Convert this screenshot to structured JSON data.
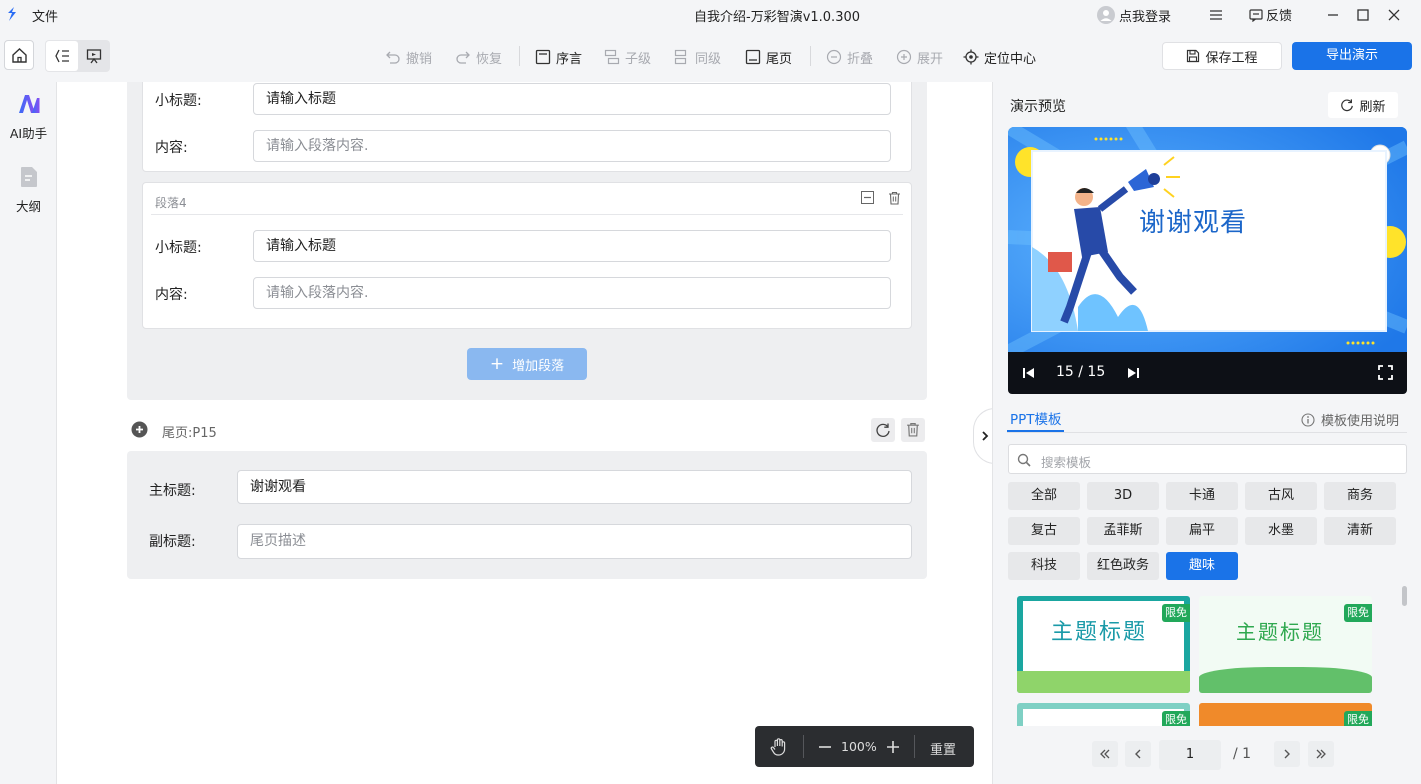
{
  "titlebar": {
    "file_menu": "文件",
    "app_title": "自我介绍-万彩智演v1.0.300",
    "login": "点我登录",
    "feedback": "反馈"
  },
  "toolbar": {
    "undo": "撤销",
    "redo": "恢复",
    "preface": "序言",
    "child": "子级",
    "sibling": "同级",
    "ending": "尾页",
    "collapse": "折叠",
    "expand": "展开",
    "locate_center": "定位中心",
    "save_project": "保存工程",
    "export": "导出演示"
  },
  "left_rail": {
    "ai_assistant": "AI助手",
    "outline": "大纲"
  },
  "editor": {
    "paragraph3": {
      "subtitle_label": "小标题:",
      "subtitle_placeholder": "请输入标题",
      "content_label": "内容:",
      "content_placeholder": "请输入段落内容."
    },
    "paragraph4": {
      "header": "段落4",
      "subtitle_label": "小标题:",
      "subtitle_placeholder": "请输入标题",
      "content_label": "内容:",
      "content_placeholder": "请输入段落内容."
    },
    "add_paragraph": "增加段落",
    "ending_page": {
      "header": "尾页:P15",
      "main_title_label": "主标题:",
      "main_title_value": "谢谢观看",
      "sub_title_label": "副标题:",
      "sub_title_placeholder": "尾页描述"
    }
  },
  "zoom_bar": {
    "zoom_level": "100%",
    "reset": "重置"
  },
  "preview": {
    "title": "演示预览",
    "refresh": "刷新",
    "slide_text": "谢谢观看",
    "counter": "15 / 15"
  },
  "templates": {
    "tab": "PPT模板",
    "help": "模板使用说明",
    "search_placeholder": "搜索模板",
    "categories": [
      "全部",
      "3D",
      "卡通",
      "古风",
      "商务",
      "复古",
      "孟菲斯",
      "扁平",
      "水墨",
      "清新",
      "科技",
      "红色政务",
      "趣味"
    ],
    "active_category": "趣味",
    "thumbs": [
      {
        "title": "主题标题",
        "badge": "限免",
        "title_color": "#1a9aa8"
      },
      {
        "title": "主题标题",
        "badge": "限免",
        "title_color": "#2fa84f"
      },
      {
        "title": "",
        "badge": "限免",
        "title_color": "#1a9aa8"
      },
      {
        "title": "",
        "badge": "限免",
        "title_color": "#f08a2a"
      }
    ],
    "page_current": "1",
    "page_total": "/ 1"
  },
  "colors": {
    "accent": "#1a73e8",
    "add_button": "#8ab8f0",
    "player_bar": "#0d1016"
  }
}
